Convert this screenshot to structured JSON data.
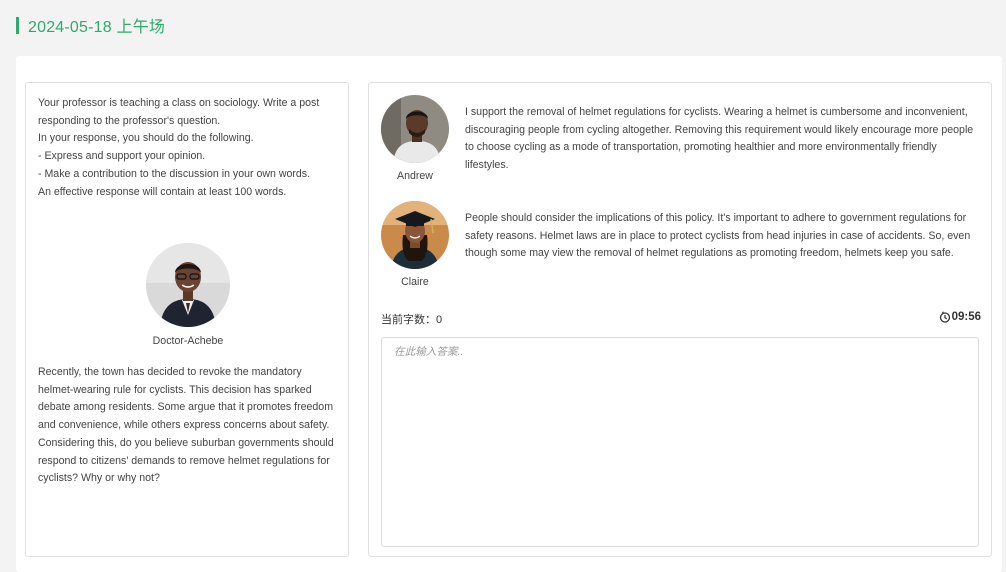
{
  "header": {
    "title": "2024-05-18 上午场",
    "accent_color": "#2eaa6c"
  },
  "instructions": {
    "lines": [
      "Your professor is teaching a class on sociology. Write a post responding to the professor's question.",
      "In your response, you should do the following.",
      "- Express and support your opinion.",
      "- Make a contribution to the discussion in your own words.",
      "An effective response will contain at least 100 words."
    ]
  },
  "professor": {
    "name": "Doctor-Achebe",
    "avatar_icon": "person-avatar-icon",
    "question": "Recently, the town has decided to revoke the mandatory helmet-wearing rule for cyclists. This decision has sparked debate among residents. Some argue that it promotes freedom and convenience, while others express concerns about safety. Considering this, do you believe suburban governments should respond to citizens' demands to remove helmet regulations for cyclists? Why or why not?"
  },
  "students": [
    {
      "name": "Andrew",
      "avatar_icon": "person-avatar-icon",
      "post": "I support the removal of helmet regulations for cyclists. Wearing a helmet is cumbersome and inconvenient, discouraging people from cycling altogether. Removing this requirement would likely encourage more people to choose cycling as a mode of transportation, promoting healthier and more environmentally friendly lifestyles."
    },
    {
      "name": "Claire",
      "avatar_icon": "graduate-avatar-icon",
      "post": "People should consider the implications of this policy. It's important to adhere to government regulations for safety reasons. Helmet laws are in place to protect cyclists from head injuries in case of accidents. So, even though some may view the removal of helmet regulations as promoting freedom, helmets keep you safe."
    }
  ],
  "editor": {
    "word_count_label": "当前字数：0",
    "timer": "09:56",
    "timer_icon": "clock-icon",
    "placeholder": "在此输入答案..",
    "value": ""
  }
}
